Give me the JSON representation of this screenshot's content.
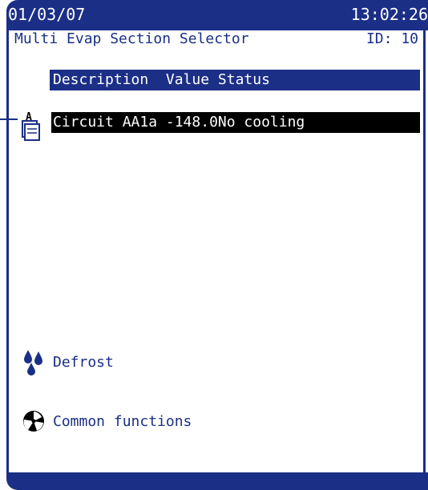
{
  "header": {
    "date": "01/03/07",
    "time": "13:02:26",
    "title": "Multi Evap Section Selector",
    "id_label": "ID: 10"
  },
  "table": {
    "column_header": "Description  Value Status",
    "rows": [
      {
        "text": "Circuit AA1a -148.0No cooling",
        "icon": "document-a-icon"
      }
    ]
  },
  "nav": {
    "defrost": {
      "label": "Defrost",
      "icon": "water-drops-icon"
    },
    "common": {
      "label": "Common functions",
      "icon": "fan-icon"
    }
  },
  "colors": {
    "primary": "#1b2f86",
    "selected_row": "#000000",
    "background": "#ffffff"
  }
}
